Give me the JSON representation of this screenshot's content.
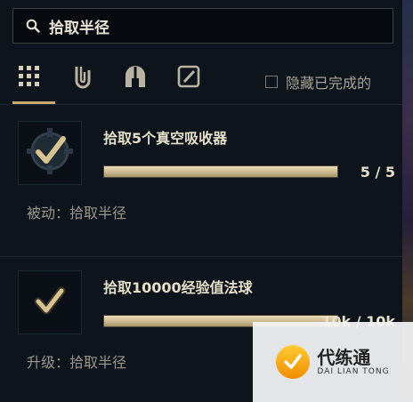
{
  "search": {
    "value": "拾取半径",
    "placeholder": ""
  },
  "tabs": [
    {
      "name": "all",
      "icon": "grid-icon",
      "selected": true
    },
    {
      "name": "items",
      "icon": "paperclip-icon",
      "selected": false
    },
    {
      "name": "champions",
      "icon": "helmet-icon",
      "selected": false
    },
    {
      "name": "completed",
      "icon": "slash-box-icon",
      "selected": false
    }
  ],
  "filter": {
    "hide_completed_label": "隐藏已完成的",
    "checked": false
  },
  "quests": [
    {
      "title": "拾取5个真空吸收器",
      "progress_text": "5 / 5",
      "progress_fraction": 1.0,
      "subtitle": "被动：拾取半径",
      "icon": "check-on-gear-icon"
    },
    {
      "title": "拾取10000经验值法球",
      "progress_text": "10k / 10k",
      "progress_fraction": 1.0,
      "subtitle": "升级：拾取半径",
      "icon": "check-icon"
    }
  ],
  "watermark": {
    "main": "代练通",
    "sub": "DAI LIAN TONG"
  },
  "colors": {
    "accent_gold": "#c8aa6e",
    "background": "#0d141b",
    "title_text": "#e6dfca"
  }
}
